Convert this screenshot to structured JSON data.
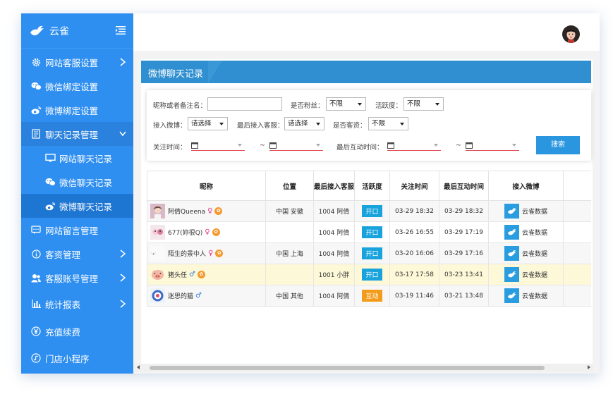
{
  "app": {
    "name": "云雀"
  },
  "colors": {
    "sidebar": "#2f8ff0",
    "accent": "#2a96e0",
    "highlight_row": "#fdf8d8",
    "badge_open": "#19a3dd",
    "badge_interact": "#f39c1c"
  },
  "sidebar": {
    "items": [
      {
        "label": "网站客服设置",
        "icon": "gear-icon",
        "arrow": "chevron-right-icon"
      },
      {
        "label": "微信绑定设置",
        "icon": "wechat-icon"
      },
      {
        "label": "微博绑定设置",
        "icon": "weibo-icon"
      },
      {
        "label": "聊天记录管理",
        "icon": "document-icon",
        "arrow": "chevron-down-icon"
      },
      {
        "label": "网站留言管理",
        "icon": "message-icon"
      },
      {
        "label": "客资管理",
        "icon": "info-icon",
        "arrow": "chevron-right-icon"
      },
      {
        "label": "客服账号管理",
        "icon": "user-icon",
        "arrow": "chevron-right-icon"
      },
      {
        "label": "统计报表",
        "icon": "bar-chart-icon",
        "arrow": "chevron-right-icon"
      },
      {
        "label": "充值续费",
        "icon": "yen-icon"
      },
      {
        "label": "门店小程序",
        "icon": "miniprogram-icon"
      }
    ],
    "sub_items": [
      {
        "label": "网站聊天记录",
        "icon": "monitor-icon"
      },
      {
        "label": "微信聊天记录",
        "icon": "wechat-icon"
      },
      {
        "label": "微博聊天记录",
        "icon": "weibo-icon",
        "active": true
      }
    ]
  },
  "page": {
    "title": "微博聊天记录"
  },
  "filters": {
    "nickname_label": "昵称或者备注名：",
    "is_fan_label": "是否粉丝：",
    "is_fan_value": "不限",
    "activity_label": "活跃度：",
    "activity_value": "不限",
    "weibo_label": "接入微博：",
    "weibo_value": "请选择",
    "last_agent_label": "最后接入客服：",
    "last_agent_value": "请选择",
    "is_lead_label": "是否客资：",
    "is_lead_value": "不限",
    "follow_time_label": "关注时间：",
    "last_interact_label": "最后互动时间：",
    "tilde": "~",
    "search_label": "搜索"
  },
  "table": {
    "columns": [
      "昵称",
      "位置",
      "最后接入客服",
      "活跃度",
      "关注时间",
      "最后互动时间",
      "接入微博"
    ],
    "rows": [
      {
        "nickname": "阿倩Queena",
        "gender": "♀",
        "location": "中国 安徽",
        "agent": "1004 阿倩",
        "activity": "开口",
        "follow": "03-29 18:32",
        "last": "03-29 18:32",
        "weibo": "云雀数据"
      },
      {
        "nickname": "677(妳很Q)",
        "gender": "♀",
        "location": "",
        "agent": "1004 阿倩",
        "activity": "开口",
        "follow": "03-26 16:55",
        "last": "03-29 17:19",
        "weibo": "云雀数据"
      },
      {
        "nickname": "陌生的景中人",
        "gender": "♀",
        "location": "中国 上海",
        "agent": "1004 阿倩",
        "activity": "开口",
        "follow": "03-20 16:06",
        "last": "03-29 17:16",
        "weibo": "云雀数据"
      },
      {
        "nickname": "猪头任",
        "gender": "♂",
        "location": "",
        "agent": "1001 小胖",
        "activity": "开口",
        "follow": "03-17 17:58",
        "last": "03-23 13:41",
        "weibo": "云雀数据"
      },
      {
        "nickname": "迷思的猫",
        "gender": "♂",
        "location": "中国 其他",
        "agent": "1004 阿倩",
        "activity": "互动",
        "follow": "03-19 11:46",
        "last": "03-21 13:48",
        "weibo": "云雀数据"
      }
    ]
  }
}
